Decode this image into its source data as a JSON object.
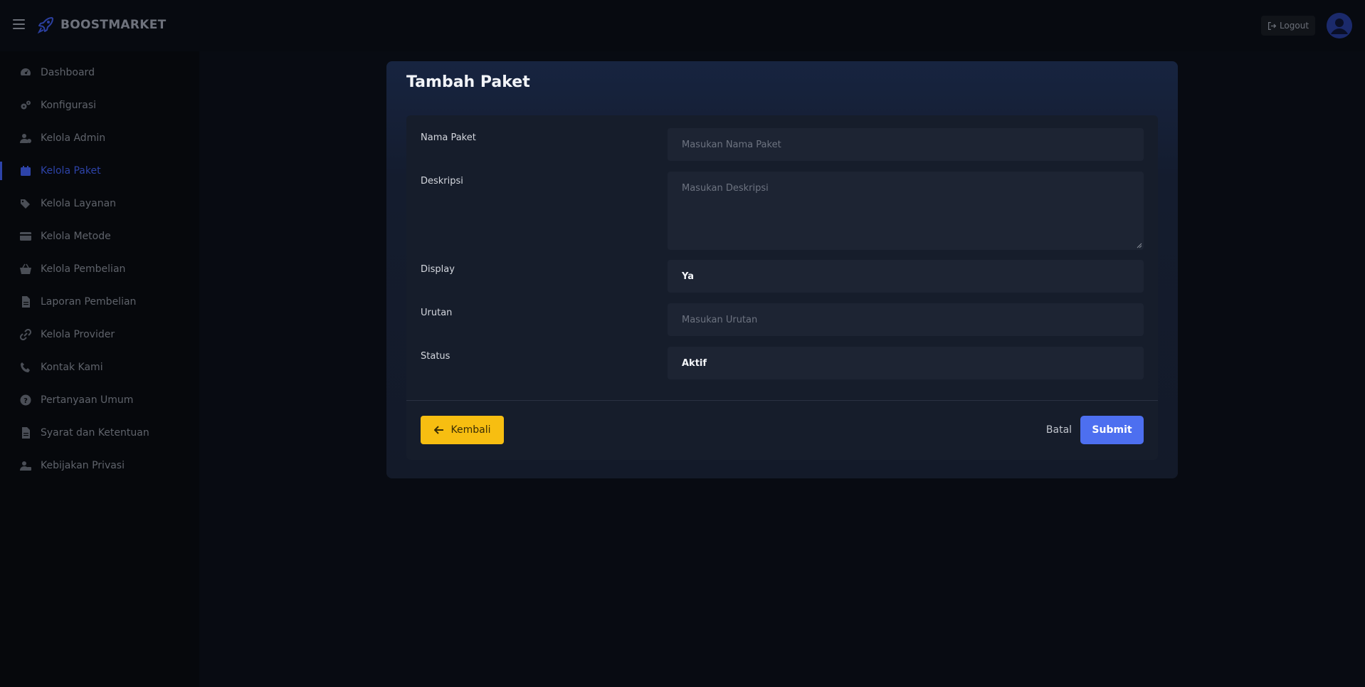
{
  "brand": {
    "name": "BOOSTMARKET",
    "logo_icon": "rocket-icon"
  },
  "header": {
    "logout_label": "Logout",
    "logout_icon": "sign-out-icon",
    "avatar_icon": "user-circle-icon"
  },
  "sidebar": {
    "items": [
      {
        "label": "Dashboard",
        "icon": "gauge-icon"
      },
      {
        "label": "Konfigurasi",
        "icon": "gears-icon"
      },
      {
        "label": "Kelola Admin",
        "icon": "user-gear-icon"
      },
      {
        "label": "Kelola Paket",
        "icon": "calendar-icon",
        "active": true
      },
      {
        "label": "Kelola Layanan",
        "icon": "tags-icon"
      },
      {
        "label": "Kelola Metode",
        "icon": "credit-card-icon"
      },
      {
        "label": "Kelola Pembelian",
        "icon": "basket-icon"
      },
      {
        "label": "Laporan Pembelian",
        "icon": "file-icon"
      },
      {
        "label": "Kelola Provider",
        "icon": "link-icon"
      },
      {
        "label": "Kontak Kami",
        "icon": "phone-icon"
      },
      {
        "label": "Pertanyaan Umum",
        "icon": "question-circle-icon"
      },
      {
        "label": "Syarat dan Ketentuan",
        "icon": "file-icon"
      },
      {
        "label": "Kebijakan Privasi",
        "icon": "user-lock-icon"
      }
    ]
  },
  "form": {
    "title": "Tambah Paket",
    "fields": {
      "nama_paket": {
        "label": "Nama Paket",
        "placeholder": "Masukan Nama Paket"
      },
      "deskripsi": {
        "label": "Deskripsi",
        "placeholder": "Masukan Deskripsi"
      },
      "display": {
        "label": "Display",
        "value": "Ya"
      },
      "urutan": {
        "label": "Urutan",
        "placeholder": "Masukan Urutan"
      },
      "status": {
        "label": "Status",
        "value": "Aktif"
      }
    },
    "buttons": {
      "back": "Kembali",
      "cancel": "Batal",
      "submit": "Submit"
    }
  },
  "colors": {
    "accent": "#4d6ff0",
    "warning": "#f7be11",
    "active_nav": "#2d43a8",
    "background": "#070a10"
  }
}
